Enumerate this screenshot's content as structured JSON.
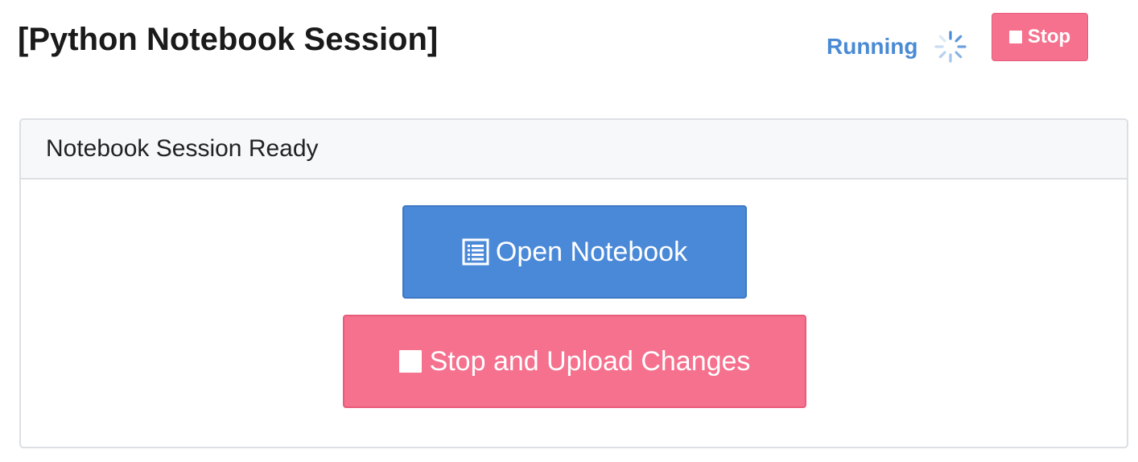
{
  "header": {
    "title": "[Python Notebook Session]",
    "status": "Running",
    "status_icon": "spinner-icon",
    "stop_button": {
      "label": "Stop",
      "icon": "stop-square-icon"
    }
  },
  "panel": {
    "heading": "Notebook Session Ready",
    "open_button": {
      "label": "Open Notebook",
      "icon": "notebook-list-icon"
    },
    "stop_upload_button": {
      "label": "Stop and Upload Changes",
      "icon": "stop-square-icon"
    }
  },
  "colors": {
    "primary": "#4a89d8",
    "danger": "#f5718e",
    "status": "#4a8ad4"
  }
}
